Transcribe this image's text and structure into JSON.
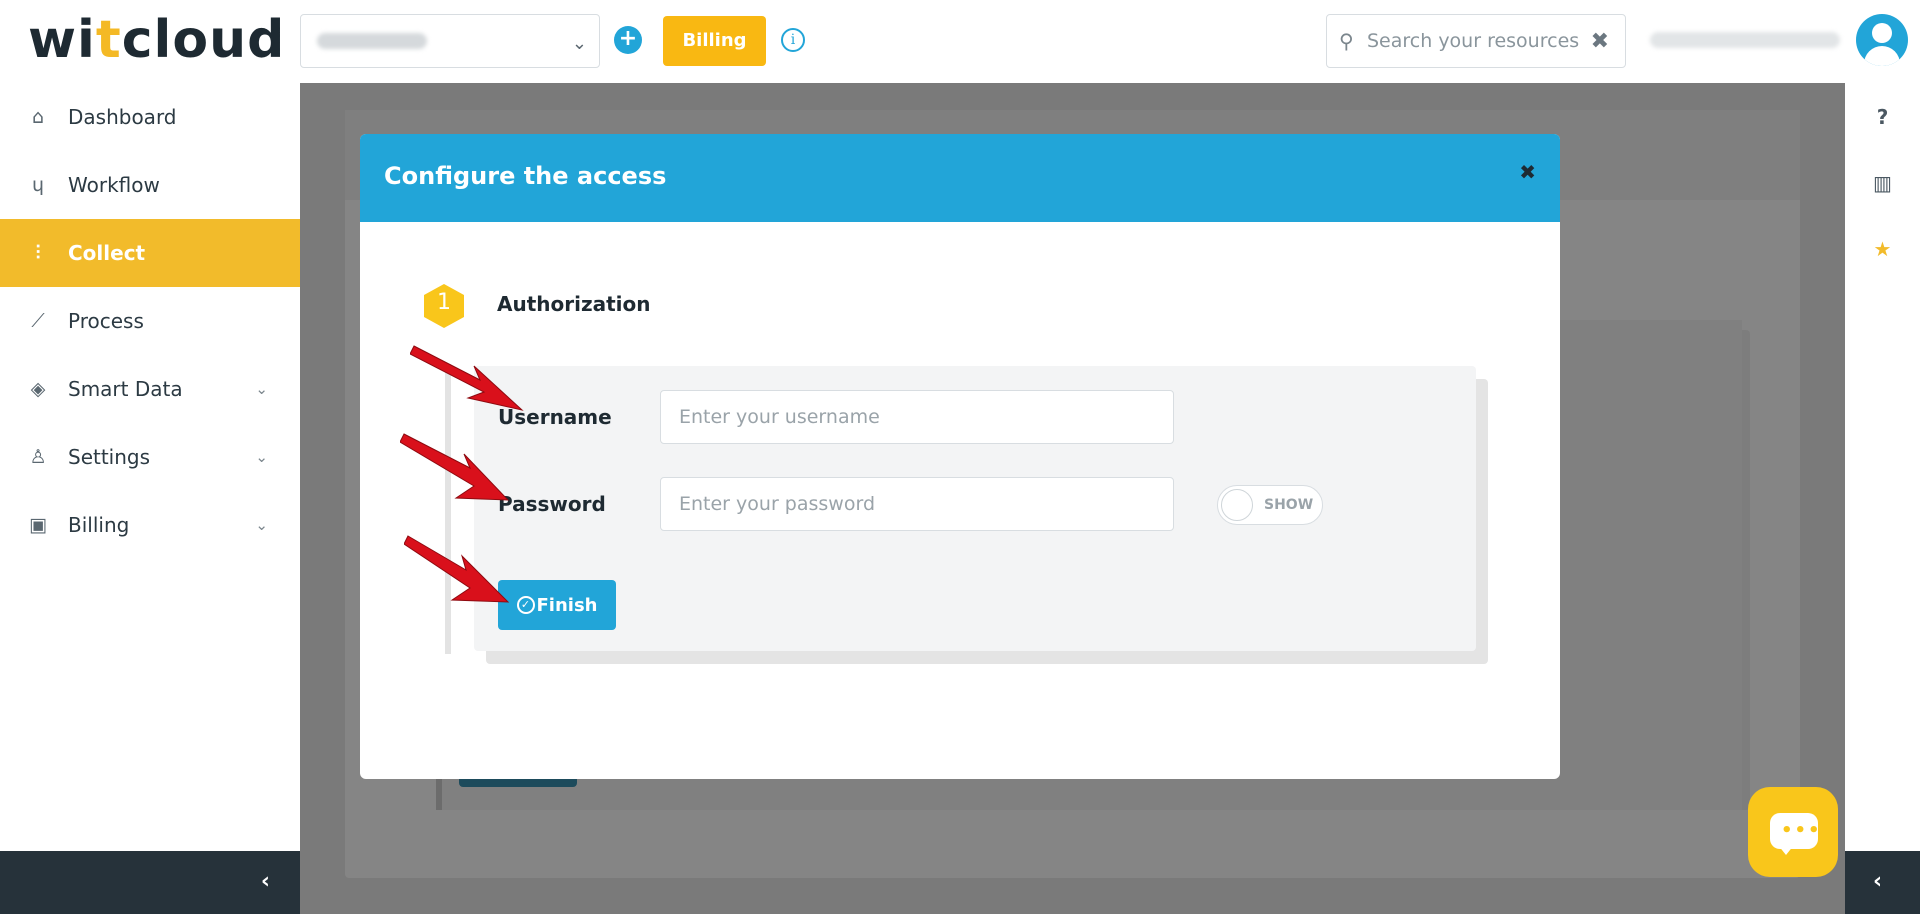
{
  "header": {
    "logo_prefix": "wi",
    "logo_accent": "t",
    "logo_suffix": "cloud",
    "add_icon": "+",
    "billing_label": "Billing",
    "info_icon": "i",
    "search_placeholder": "Search your resources",
    "search_clear": "✖",
    "search_icon": "⚲"
  },
  "sidebar": {
    "items": [
      {
        "label": "Dashboard",
        "icon": "home-icon"
      },
      {
        "label": "Workflow",
        "icon": "branch-icon"
      },
      {
        "label": "Collect",
        "icon": "sliders-icon",
        "active": true
      },
      {
        "label": "Process",
        "icon": "line-chart-icon"
      },
      {
        "label": "Smart Data",
        "icon": "layers-icon",
        "expandable": true
      },
      {
        "label": "Settings",
        "icon": "user-icon",
        "expandable": true
      },
      {
        "label": "Billing",
        "icon": "money-icon",
        "expandable": true
      }
    ],
    "collapse_icon": "‹"
  },
  "rail": {
    "help_icon": "?",
    "book_icon": "▥",
    "star_icon": "★",
    "expand_icon": "‹"
  },
  "modal": {
    "title": "Configure the access",
    "close": "✖",
    "step_number": "1",
    "step_title": "Authorization",
    "username_label": "Username",
    "username_placeholder": "Enter your username",
    "password_label": "Password",
    "password_placeholder": "Enter your password",
    "show_toggle": "SHOW",
    "finish_label": "Finish"
  },
  "colors": {
    "accent_blue": "#22a5d8",
    "accent_yellow": "#f2bb2b",
    "dark": "#26323a",
    "arrow_red": "#d9101b"
  }
}
